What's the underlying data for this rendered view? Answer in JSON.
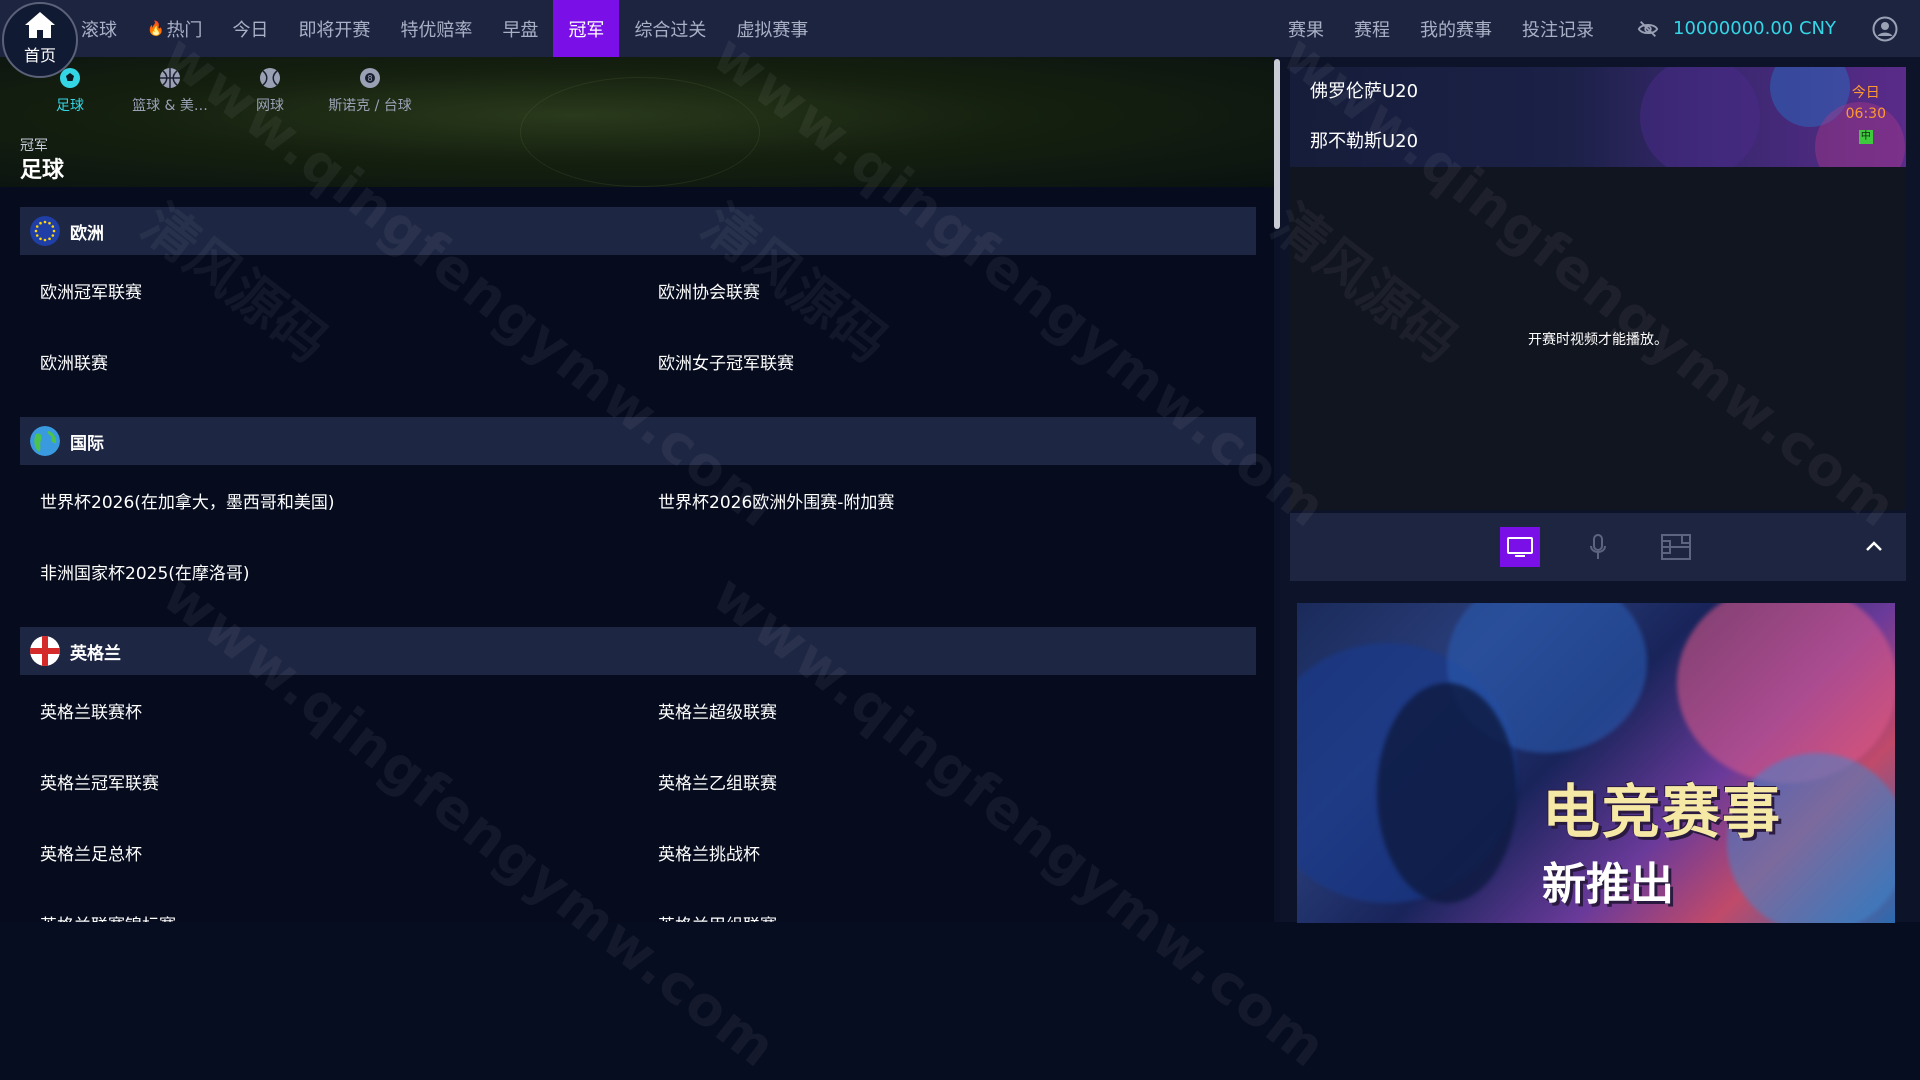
{
  "home": {
    "label": "首页"
  },
  "nav": {
    "items": [
      {
        "label": "滚球",
        "active": false
      },
      {
        "label": "热门",
        "active": false,
        "hot": true
      },
      {
        "label": "今日",
        "active": false
      },
      {
        "label": "即将开赛",
        "active": false
      },
      {
        "label": "特优赔率",
        "active": false
      },
      {
        "label": "早盘",
        "active": false
      },
      {
        "label": "冠军",
        "active": true
      },
      {
        "label": "综合过关",
        "active": false
      },
      {
        "label": "虚拟赛事",
        "active": false
      }
    ],
    "right_items": [
      "赛果",
      "赛程",
      "我的赛事",
      "投注记录"
    ],
    "balance": "10000000.00  CNY",
    "accent_color": "#7a0fe8",
    "balance_color": "#34d6e6"
  },
  "sports": [
    {
      "label": "足球",
      "icon": "soccer-ball-icon",
      "active": true
    },
    {
      "label": "篮球 & 美…",
      "icon": "basketball-icon",
      "active": false
    },
    {
      "label": "网球",
      "icon": "tennis-ball-icon",
      "active": false
    },
    {
      "label": "斯诺克 / 台球",
      "icon": "billiard-ball-icon",
      "active": false
    }
  ],
  "page": {
    "crumb": "冠军",
    "title": "足球"
  },
  "regions": [
    {
      "name": "欧洲",
      "flag": "eu-flag-icon",
      "leagues": [
        "欧洲冠军联赛",
        "欧洲协会联赛",
        "欧洲联赛",
        "欧洲女子冠军联赛"
      ]
    },
    {
      "name": "国际",
      "flag": "globe-icon",
      "leagues": [
        "世界杯2026(在加拿大，墨西哥和美国)",
        "世界杯2026欧洲外围赛-附加赛",
        "非洲国家杯2025(在摩洛哥)"
      ]
    },
    {
      "name": "英格兰",
      "flag": "england-flag-icon",
      "leagues": [
        "英格兰联赛杯",
        "英格兰超级联赛",
        "英格兰冠军联赛",
        "英格兰乙组联赛",
        "英格兰足总杯",
        "英格兰挑战杯",
        "英格兰联赛锦标赛",
        "英格兰甲组联赛"
      ]
    }
  ],
  "match": {
    "home": "佛罗伦萨U20",
    "away": "那不勒斯U20",
    "day": "今日",
    "time": "06:30",
    "badge": "中"
  },
  "video": {
    "message": "开赛时视频才能播放。"
  },
  "promo": {
    "line1": "电竞赛事",
    "line2": "新推出"
  },
  "watermark": {
    "url": "www.qingfengymw.com",
    "cn": "清风源码"
  }
}
